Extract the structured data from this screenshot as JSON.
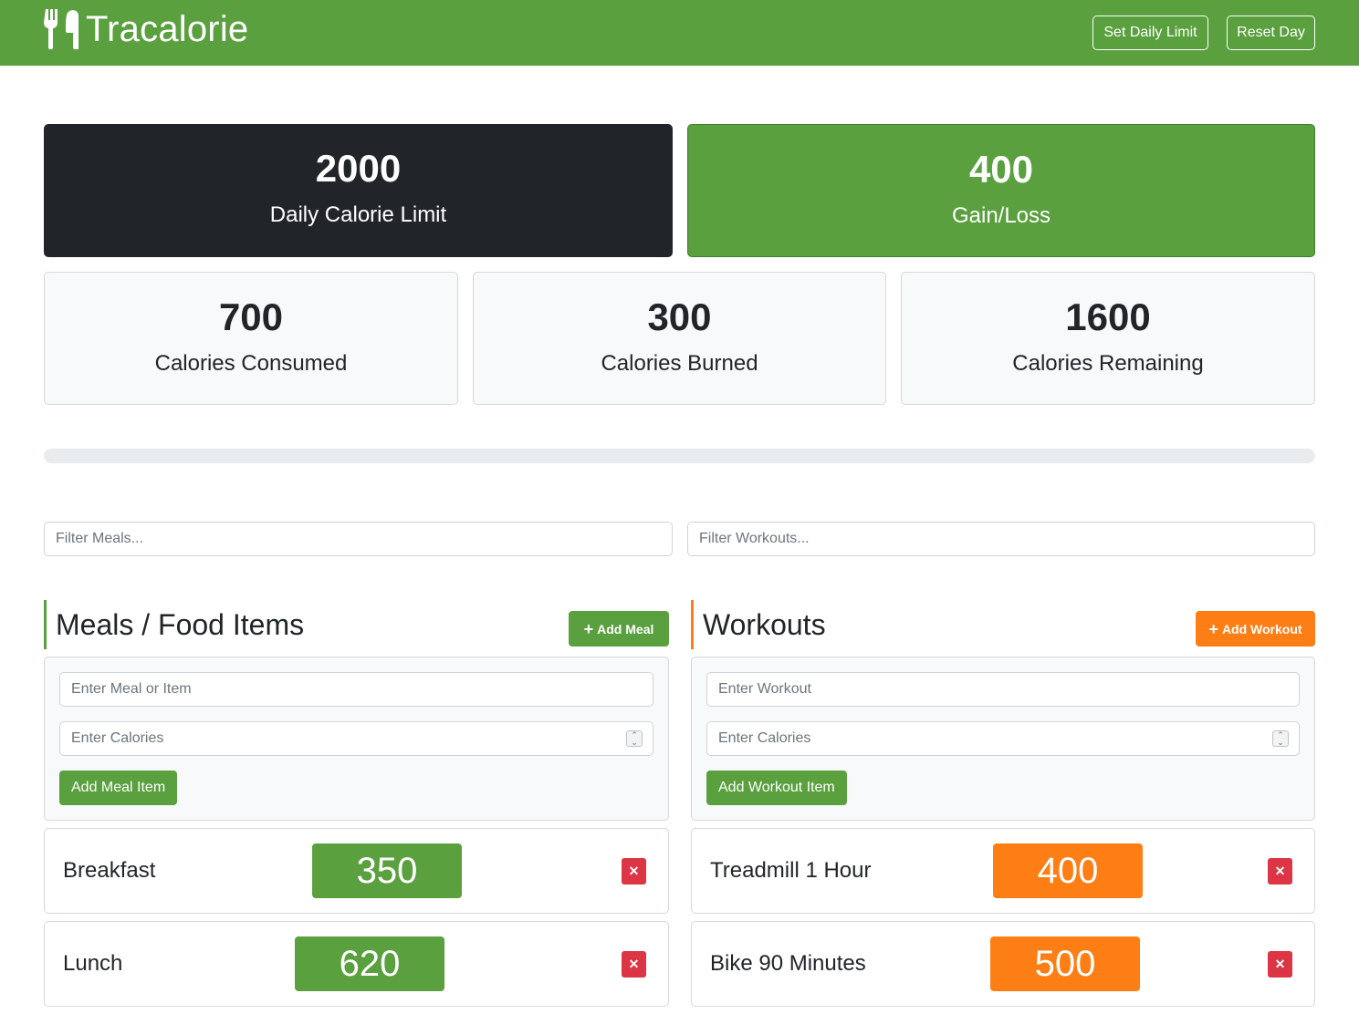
{
  "navbar": {
    "brand": "Tracalorie",
    "brand_icon": "utensils-icon",
    "set_limit_label": "Set Daily Limit",
    "reset_label": "Reset Day"
  },
  "stats": {
    "limit": {
      "value": "2000",
      "label": "Daily Calorie Limit"
    },
    "gain": {
      "value": "400",
      "label": "Gain/Loss"
    },
    "consumed": {
      "value": "700",
      "label": "Calories Consumed"
    },
    "burned": {
      "value": "300",
      "label": "Calories Burned"
    },
    "remaining": {
      "value": "1600",
      "label": "Calories Remaining"
    }
  },
  "progress": {
    "percent": 0
  },
  "filters": {
    "meals_placeholder": "Filter Meals...",
    "workouts_placeholder": "Filter Workouts..."
  },
  "meals": {
    "title": "Meals / Food Items",
    "add_label": "Add Meal",
    "name_placeholder": "Enter Meal or Item",
    "calories_placeholder": "Enter Calories",
    "submit_label": "Add Meal Item",
    "items": [
      {
        "name": "Breakfast",
        "calories": "350"
      },
      {
        "name": "Lunch",
        "calories": "620"
      }
    ]
  },
  "workouts": {
    "title": "Workouts",
    "add_label": "Add Workout",
    "name_placeholder": "Enter Workout",
    "calories_placeholder": "Enter Calories",
    "submit_label": "Add Workout Item",
    "items": [
      {
        "name": "Treadmill 1 Hour",
        "calories": "400"
      },
      {
        "name": "Bike 90 Minutes",
        "calories": "500"
      }
    ]
  },
  "colors": {
    "primary_green": "#5aa03f",
    "dark": "#212529",
    "orange": "#fd7e14",
    "danger": "#dc3545"
  }
}
